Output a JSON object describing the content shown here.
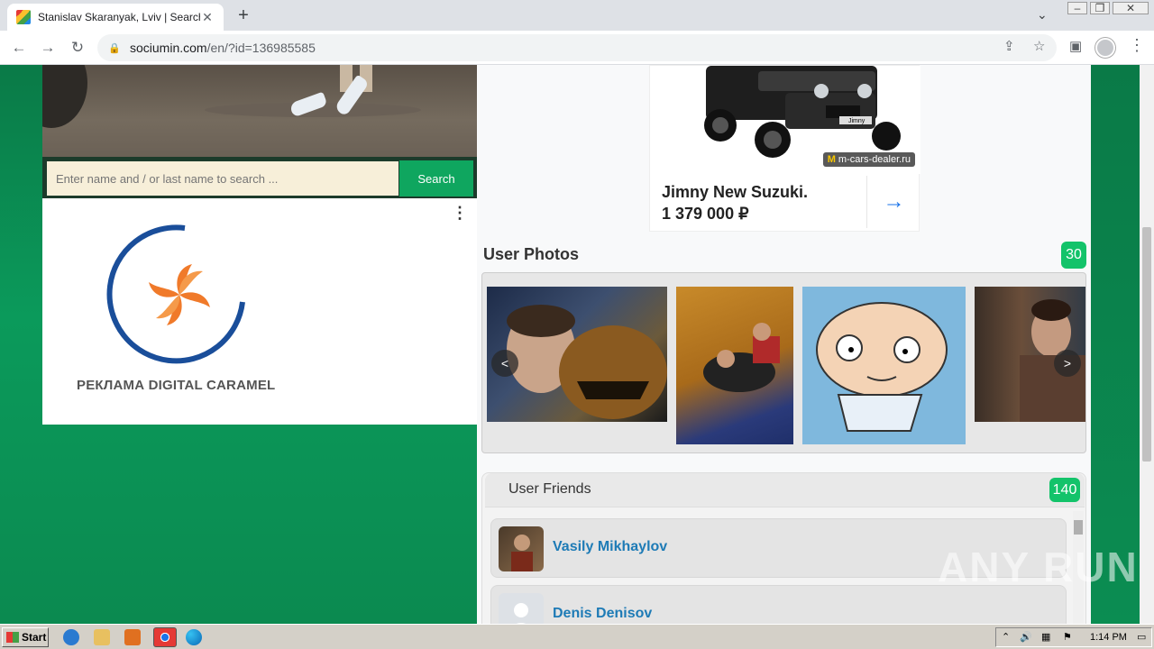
{
  "browser": {
    "tab_title": "Stanislav Skaranyak, Lviv | Search In",
    "tab_close": "✕",
    "new_tab": "+",
    "url_host": "sociumin.com",
    "url_path": "/en/?id=136985585"
  },
  "search": {
    "placeholder": "Enter name and / or last name to search ...",
    "button_label": "Search"
  },
  "left_ad": {
    "caption": "РЕКЛАМА DIGITAL CARAMEL",
    "menu": "⋮"
  },
  "car_ad": {
    "dealer": "m-cars-dealer.ru",
    "dealer_logo": "M",
    "name_line1": "Jimny New Suzuki.",
    "name_line2": "1 379 000 ₽",
    "arrow": "→",
    "plate_text": "Jimny"
  },
  "user_photos": {
    "title": "User Photos",
    "count": "30",
    "prev": "<",
    "next": ">"
  },
  "user_friends": {
    "title": "User Friends",
    "count": "140",
    "items": [
      {
        "name": "Vasily Mikhaylov"
      },
      {
        "name": "Denis Denisov"
      }
    ]
  },
  "watermark": "ANY RUN",
  "taskbar": {
    "start_label": "Start",
    "clock": "1:14 PM"
  },
  "colors": {
    "accent_green": "#13c36a",
    "search_button": "#0fa65f",
    "link_blue": "#1e7bb6",
    "page_bg": "#0b8a50"
  }
}
